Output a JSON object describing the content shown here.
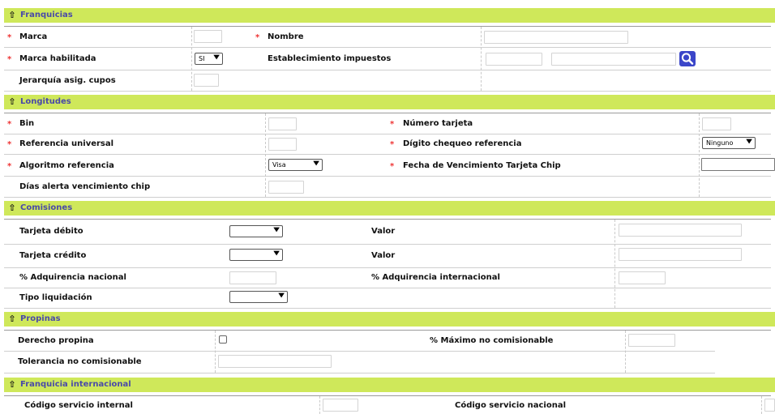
{
  "sections": {
    "franquicias": {
      "title": "Franquicias",
      "marca_label": "Marca",
      "nombre_label": "Nombre",
      "marca_habilitada_label": "Marca habilitada",
      "marca_habilitada_value": "SI",
      "establecimiento_label": "Establecimiento impuestos",
      "jerarquia_label": "Jerarquía asig. cupos"
    },
    "longitudes": {
      "title": "Longitudes",
      "bin_label": "Bin",
      "numero_tarjeta_label": "Número tarjeta",
      "referencia_universal_label": "Referencia universal",
      "digito_label": "Dígito chequeo referencia",
      "digito_value": "Ninguno",
      "algoritmo_label": "Algoritmo referencia",
      "algoritmo_value": "Visa",
      "fecha_label": "Fecha de Vencimiento Tarjeta Chip",
      "dias_label": "Días alerta vencimiento chip"
    },
    "comisiones": {
      "title": "Comisiones",
      "tarjeta_debito_label": "Tarjeta débito",
      "valor1_label": "Valor",
      "tarjeta_credito_label": "Tarjeta crédito",
      "valor2_label": "Valor",
      "adq_nacional_label": "% Adquirencia nacional",
      "adq_internacional_label": "% Adquirencia internacional",
      "tipo_liquidacion_label": "Tipo liquidación"
    },
    "propinas": {
      "title": "Propinas",
      "derecho_label": "Derecho propina",
      "maximo_label": "% Máximo no comisionable",
      "tolerancia_label": "Tolerancia no comisionable"
    },
    "franquicia_internacional": {
      "title": "Franquicia internacional",
      "codigo_internal_label": "Código servicio internal",
      "codigo_nacional_label": "Código servicio nacional"
    }
  },
  "required_mark": "*",
  "icons": {
    "collapse": "arrow-up-icon",
    "search": "search-icon"
  },
  "colors": {
    "section_bar": "#cfe85a",
    "section_title": "#4a4aa8",
    "required": "#e33333",
    "search_button": "#3b46c9"
  }
}
